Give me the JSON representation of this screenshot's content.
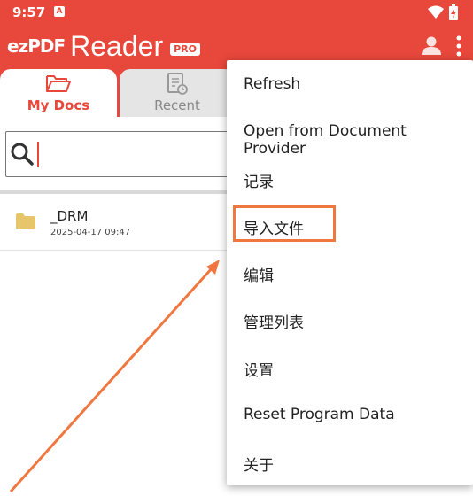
{
  "status_bar": {
    "time": "9:57",
    "notification_icon": "a-icon",
    "wifi_icon": "wifi-icon",
    "battery_icon": "battery-charging-icon"
  },
  "app_bar": {
    "logo_ez": "ezPDF",
    "logo_reader": "Reader",
    "logo_badge": "PRO",
    "user_icon": "user-icon",
    "more_icon": "more-vert-icon"
  },
  "tabs": [
    {
      "label": "My Docs",
      "icon": "folder-open-icon",
      "active": true
    },
    {
      "label": "Recent",
      "icon": "recent-doc-icon",
      "active": false
    }
  ],
  "search": {
    "value": "",
    "icon": "search-icon"
  },
  "files": [
    {
      "name": "_DRM",
      "date": "2025-04-17 09:47",
      "icon": "folder-icon"
    }
  ],
  "menu": {
    "items": [
      {
        "label": "Refresh"
      },
      {
        "label": "Open from Document Provider"
      },
      {
        "label": "记录"
      },
      {
        "label": "导入文件"
      },
      {
        "label": "编辑"
      },
      {
        "label": "管理列表"
      },
      {
        "label": "设置"
      },
      {
        "label": "Reset Program Data"
      },
      {
        "label": "关于"
      }
    ],
    "highlighted_index": 3
  },
  "colors": {
    "brand": "#e8473b",
    "highlight": "#f07840"
  }
}
